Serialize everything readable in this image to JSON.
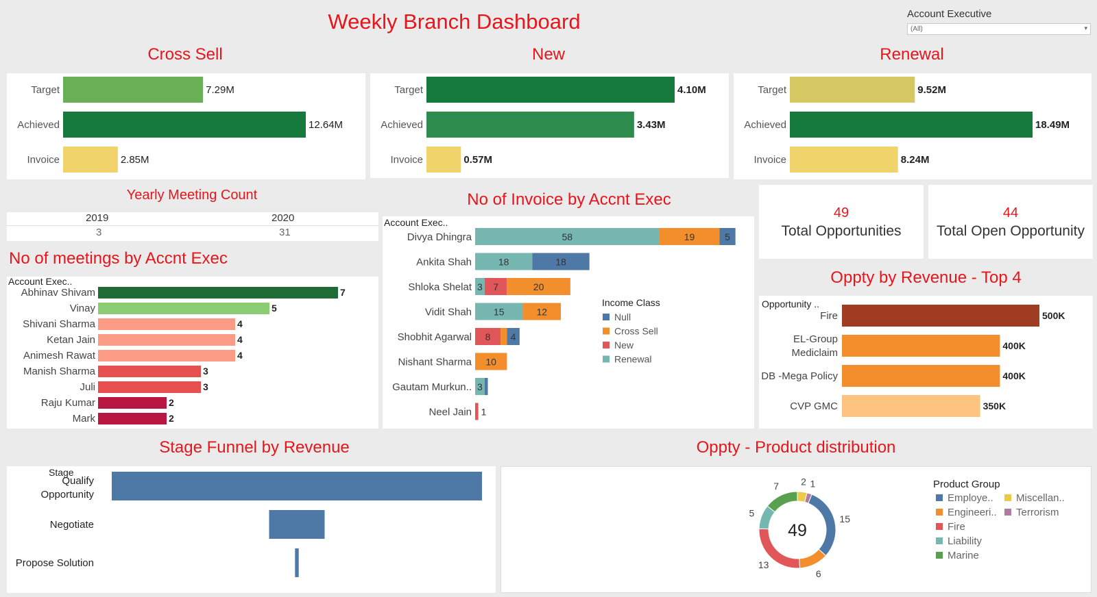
{
  "title": "Weekly Branch Dashboard",
  "filter": {
    "label": "Account Executive",
    "value": "(All)"
  },
  "colors": {
    "green_dark": "#157a3c",
    "green_mid": "#2e8b4e",
    "green_light": "#6aae55",
    "gold": "#d5c863",
    "yellow": "#f1d36c",
    "blue": "#4e79a7",
    "orange": "#f28e2b",
    "red": "#e15759",
    "teal": "#76b7b2",
    "accent": "#e8151b"
  },
  "cross_sell": {
    "title": "Cross Sell",
    "bars": [
      {
        "label": "Target",
        "value": 7.29,
        "text": "7.29M",
        "color": "#6aae55"
      },
      {
        "label": "Achieved",
        "value": 12.64,
        "text": "12.64M",
        "color": "#157a3c"
      },
      {
        "label": "Invoice",
        "value": 2.85,
        "text": "2.85M",
        "color": "#f1d36c"
      }
    ]
  },
  "new": {
    "title": "New",
    "bars": [
      {
        "label": "Target",
        "value": 4.1,
        "text": "4.10M",
        "color": "#157a3c"
      },
      {
        "label": "Achieved",
        "value": 3.43,
        "text": "3.43M",
        "color": "#2e8b4e"
      },
      {
        "label": "Invoice",
        "value": 0.57,
        "text": "0.57M",
        "color": "#f1d36c"
      }
    ]
  },
  "renewal": {
    "title": "Renewal",
    "bars": [
      {
        "label": "Target",
        "value": 9.52,
        "text": "9.52M",
        "color": "#d5c863"
      },
      {
        "label": "Achieved",
        "value": 18.49,
        "text": "18.49M",
        "color": "#157a3c"
      },
      {
        "label": "Invoice",
        "value": 8.24,
        "text": "8.24M",
        "color": "#f1d36c"
      }
    ]
  },
  "yearly": {
    "title": "Yearly Meeting Count",
    "years": [
      "2019",
      "2020"
    ],
    "counts": [
      "3",
      "31"
    ]
  },
  "kpis": [
    {
      "value": "49",
      "label": "Total Opportunities"
    },
    {
      "value": "44",
      "label": "Total Open Opportunity"
    }
  ],
  "chart_data": [
    {
      "type": "bar",
      "id": "meetings",
      "title": "No of meetings by Accnt Exec",
      "header": "Account Exec..",
      "categories": [
        "Abhinav Shivam",
        "Vinay",
        "Shivani Sharma",
        "Ketan Jain",
        "Animesh Rawat",
        "Manish Sharma",
        "Juli",
        "Raju Kumar",
        "Mark"
      ],
      "values": [
        7,
        5,
        4,
        4,
        4,
        3,
        3,
        2,
        2
      ],
      "colors": [
        "#1e6b36",
        "#8ccc72",
        "#fb9a85",
        "#fb9a85",
        "#fb9a85",
        "#e8504f",
        "#e8504f",
        "#b81741",
        "#b81741"
      ]
    },
    {
      "type": "bar",
      "id": "invoices",
      "title": "No of Invoice by Accnt Exec",
      "header": "Account Exec..",
      "stacked": true,
      "legend_title": "Income Class",
      "legend": [
        {
          "name": "Null",
          "color": "#4e79a7"
        },
        {
          "name": "Cross Sell",
          "color": "#f28e2b"
        },
        {
          "name": "New",
          "color": "#e15759"
        },
        {
          "name": "Renewal",
          "color": "#76b7b2"
        }
      ],
      "rows": [
        {
          "name": "Divya Dhingra",
          "segments": [
            {
              "cls": "Renewal",
              "v": 58
            },
            {
              "cls": "Cross Sell",
              "v": 19
            },
            {
              "cls": "Null",
              "v": 5
            }
          ]
        },
        {
          "name": "Ankita Shah",
          "segments": [
            {
              "cls": "Renewal",
              "v": 18
            },
            {
              "cls": "Null",
              "v": 18
            }
          ]
        },
        {
          "name": "Shloka Shelat",
          "segments": [
            {
              "cls": "Renewal",
              "v": 3
            },
            {
              "cls": "New",
              "v": 7
            },
            {
              "cls": "Cross Sell",
              "v": 20
            }
          ]
        },
        {
          "name": "Vidit Shah",
          "segments": [
            {
              "cls": "Renewal",
              "v": 15
            },
            {
              "cls": "Cross Sell",
              "v": 12
            }
          ]
        },
        {
          "name": "Shobhit Agarwal",
          "segments": [
            {
              "cls": "New",
              "v": 8
            },
            {
              "cls": "Cross Sell",
              "v": 2,
              "hide": true
            },
            {
              "cls": "Null",
              "v": 4
            }
          ]
        },
        {
          "name": "Nishant Sharma",
          "segments": [
            {
              "cls": "Cross Sell",
              "v": 10
            }
          ]
        },
        {
          "name": "Gautam Murkun..",
          "segments": [
            {
              "cls": "Renewal",
              "v": 3
            },
            {
              "cls": "Null",
              "v": 1,
              "hide": true
            }
          ]
        },
        {
          "name": "Neel Jain",
          "segments": [
            {
              "cls": "New",
              "v": 1,
              "outside": true
            }
          ]
        }
      ]
    },
    {
      "type": "bar",
      "id": "oppty_rev",
      "title": "Oppty by Revenue - Top 4",
      "header": "Opportunity ..",
      "categories": [
        "Fire",
        "EL-Group Mediclaim",
        "DB -Mega Policy",
        "CVP GMC"
      ],
      "values": [
        500,
        400,
        400,
        350
      ],
      "labels": [
        "500K",
        "400K",
        "400K",
        "350K"
      ],
      "colors": [
        "#a03c22",
        "#f28e2b",
        "#f28e2b",
        "#fdc381"
      ]
    },
    {
      "type": "bar",
      "id": "funnel",
      "title": "Stage Funnel by Revenue",
      "header": "Stage",
      "categories": [
        "Qualify Opportunity",
        "Negotiate",
        "Propose Solution"
      ],
      "values": [
        100,
        15,
        1
      ],
      "color": "#4e79a7"
    },
    {
      "type": "pie",
      "id": "product",
      "title": "Oppty - Product distribution",
      "total": "49",
      "legend_title": "Product Group",
      "slices": [
        {
          "name": "Employe..",
          "value": 15,
          "color": "#4e79a7"
        },
        {
          "name": "Engineeri..",
          "value": 6,
          "color": "#f28e2b"
        },
        {
          "name": "Fire",
          "value": 13,
          "color": "#e15759"
        },
        {
          "name": "Liability",
          "value": 5,
          "color": "#76b7b2"
        },
        {
          "name": "Marine",
          "value": 7,
          "color": "#59a14f"
        },
        {
          "name": "Miscellan..",
          "value": 2,
          "color": "#edc948"
        },
        {
          "name": "Terrorism",
          "value": 1,
          "color": "#b07aa1"
        }
      ]
    }
  ]
}
